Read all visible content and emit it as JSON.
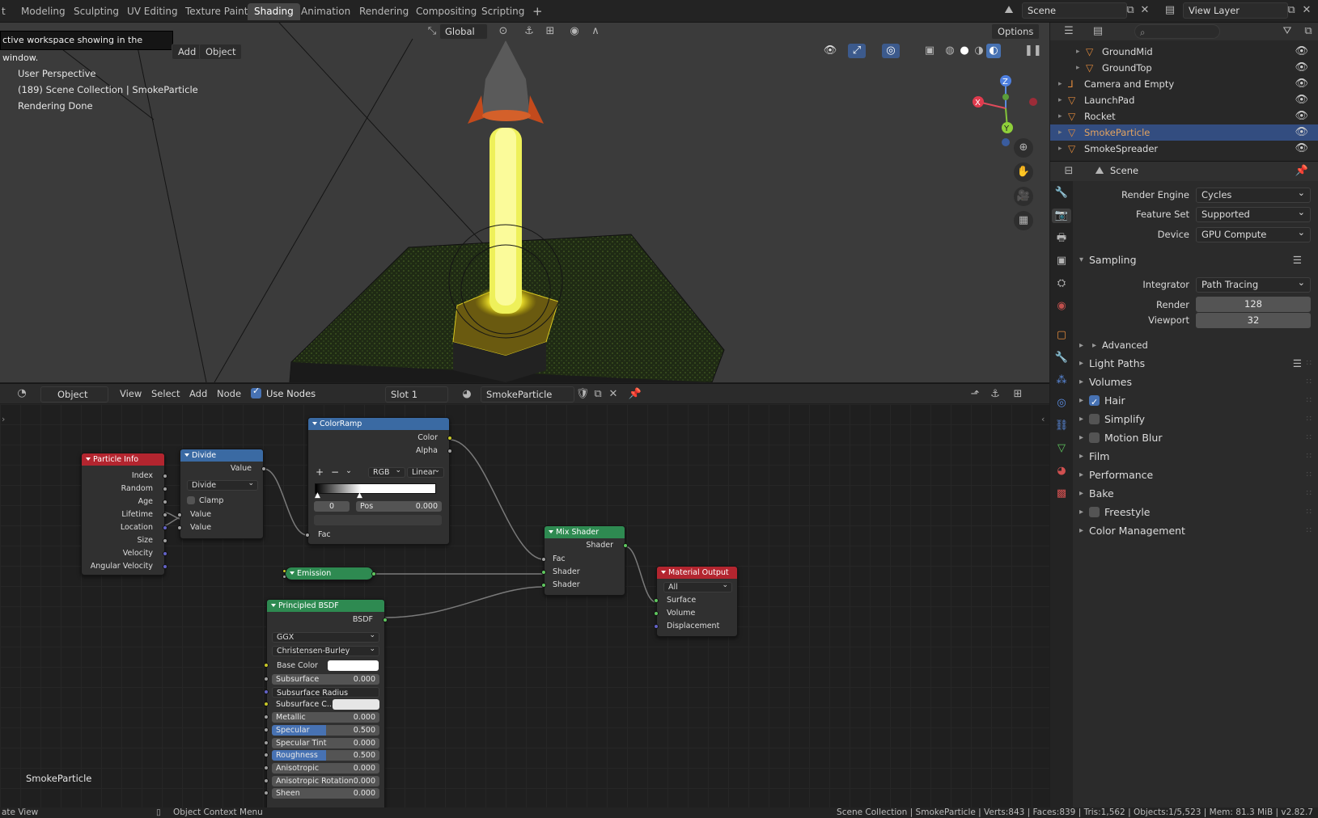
{
  "topbar": {
    "tabs": [
      "t",
      "Modeling",
      "Sculpting",
      "UV Editing",
      "Texture Paint",
      "Shading",
      "Animation",
      "Rendering",
      "Compositing",
      "Scripting"
    ],
    "active_tab": "Shading",
    "add_tab": "+",
    "scene": "Scene",
    "view_layer": "View Layer"
  },
  "viewport": {
    "tooltip": "ctive workspace showing in the window.",
    "menu_add": "Add",
    "menu_object": "Object",
    "orientation": "Global",
    "options": "Options",
    "info_line1": "User Perspective",
    "info_line2": "(189) Scene Collection | SmokeParticle",
    "info_line3": "Rendering Done",
    "axis_z": "Z",
    "axis_x": "X",
    "axis_y": "Y"
  },
  "node_header": {
    "mode": "Object",
    "menu": [
      "View",
      "Select",
      "Add",
      "Node"
    ],
    "use_nodes": "Use Nodes",
    "slot": "Slot 1",
    "material": "SmokeParticle"
  },
  "nodes": {
    "particle_info": {
      "title": "Particle Info",
      "outputs": [
        "Index",
        "Random",
        "Age",
        "Lifetime",
        "Location",
        "Size",
        "Velocity",
        "Angular Velocity"
      ]
    },
    "divide": {
      "title": "Divide",
      "out": "Value",
      "op": "Divide",
      "clamp": "Clamp",
      "in1": "Value",
      "in2": "Value"
    },
    "colorramp": {
      "title": "ColorRamp",
      "out_color": "Color",
      "out_alpha": "Alpha",
      "mode": "RGB",
      "interp": "Linear",
      "index": "0",
      "pos_label": "Pos",
      "pos_value": "0.000",
      "fac": "Fac"
    },
    "emission": {
      "title": "Emission"
    },
    "mix": {
      "title": "Mix Shader",
      "out": "Shader",
      "fac": "Fac",
      "sh1": "Shader",
      "sh2": "Shader"
    },
    "output": {
      "title": "Material Output",
      "target": "All",
      "surface": "Surface",
      "volume": "Volume",
      "displacement": "Displacement"
    },
    "bsdf": {
      "title": "Principled BSDF",
      "out": "BSDF",
      "distribution": "GGX",
      "sss_method": "Christensen-Burley",
      "base_color": "Base Color",
      "rows": [
        {
          "label": "Subsurface",
          "value": "0.000",
          "fill": 0
        },
        {
          "label": "Subsurface Radius",
          "value": "",
          "fill": 0
        },
        {
          "label": "Subsurface C...",
          "value": "",
          "fill": 0
        },
        {
          "label": "Metallic",
          "value": "0.000",
          "fill": 0
        },
        {
          "label": "Specular",
          "value": "0.500",
          "fill": 0.5
        },
        {
          "label": "Specular Tint",
          "value": "0.000",
          "fill": 0
        },
        {
          "label": "Roughness",
          "value": "0.500",
          "fill": 0.5
        },
        {
          "label": "Anisotropic",
          "value": "0.000",
          "fill": 0
        },
        {
          "label": "Anisotropic Rotation",
          "value": "0.000",
          "fill": 0
        },
        {
          "label": "Sheen",
          "value": "0.000",
          "fill": 0
        }
      ]
    },
    "canvas_label": "SmokeParticle"
  },
  "outliner": {
    "rows": [
      {
        "name": "GroundMid",
        "selected": false
      },
      {
        "name": "GroundTop",
        "selected": false
      },
      {
        "name": "Camera and Empty",
        "selected": false
      },
      {
        "name": "LaunchPad",
        "selected": false
      },
      {
        "name": "Rocket",
        "selected": false
      },
      {
        "name": "SmokeParticle",
        "selected": true
      },
      {
        "name": "SmokeSpreader",
        "selected": false
      }
    ]
  },
  "properties": {
    "context": "Scene",
    "render_engine_label": "Render Engine",
    "render_engine": "Cycles",
    "feature_set_label": "Feature Set",
    "feature_set": "Supported",
    "device_label": "Device",
    "device": "GPU Compute",
    "sampling": "Sampling",
    "integrator_label": "Integrator",
    "integrator": "Path Tracing",
    "render_label": "Render",
    "render_samples": "128",
    "viewport_label": "Viewport",
    "viewport_samples": "32",
    "advanced": "Advanced",
    "sections": [
      "Light Paths",
      "Volumes",
      "Hair",
      "Simplify",
      "Motion Blur",
      "Film",
      "Performance",
      "Bake",
      "Freestyle",
      "Color Management"
    ]
  },
  "status": {
    "left": "ate View",
    "context_menu": "Object Context Menu",
    "stats": "Scene Collection | SmokeParticle | Verts:843 | Faces:839 | Tris:1,562 | Objects:1/5,523 | Mem: 81.3 MiB | v2.82.7"
  },
  "colors": {
    "accent": "#4772b3",
    "selected_row": "#334d80",
    "shader_node": "#2e8a51",
    "input_node": "#b3252f",
    "converter_node": "#3a6aa3",
    "output_node": "#b3252f"
  }
}
